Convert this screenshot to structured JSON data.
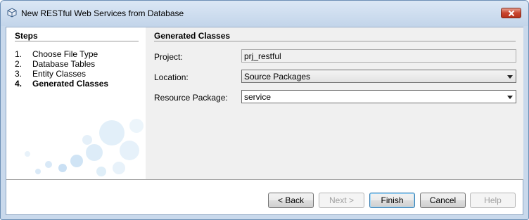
{
  "window": {
    "title": "New RESTful Web Services from Database"
  },
  "steps": {
    "heading": "Steps",
    "items": [
      {
        "num": "1.",
        "label": "Choose File Type"
      },
      {
        "num": "2.",
        "label": "Database Tables"
      },
      {
        "num": "3.",
        "label": "Entity Classes"
      },
      {
        "num": "4.",
        "label": "Generated Classes"
      }
    ]
  },
  "panel": {
    "heading": "Generated Classes",
    "project_label": "Project:",
    "project_value": "prj_restful",
    "location_label": "Location:",
    "location_value": "Source Packages",
    "package_label": "Resource Package:",
    "package_value": "service"
  },
  "buttons": {
    "back": "< Back",
    "next": "Next >",
    "finish": "Finish",
    "cancel": "Cancel",
    "help": "Help"
  },
  "colors": {
    "title_bar": "#c3d5ea",
    "close_button": "#c8452e",
    "panel_bg": "#f0f0f0"
  },
  "icons": {
    "title": "cube-icon",
    "close": "close-icon",
    "dropdown": "chevron-down-icon"
  }
}
